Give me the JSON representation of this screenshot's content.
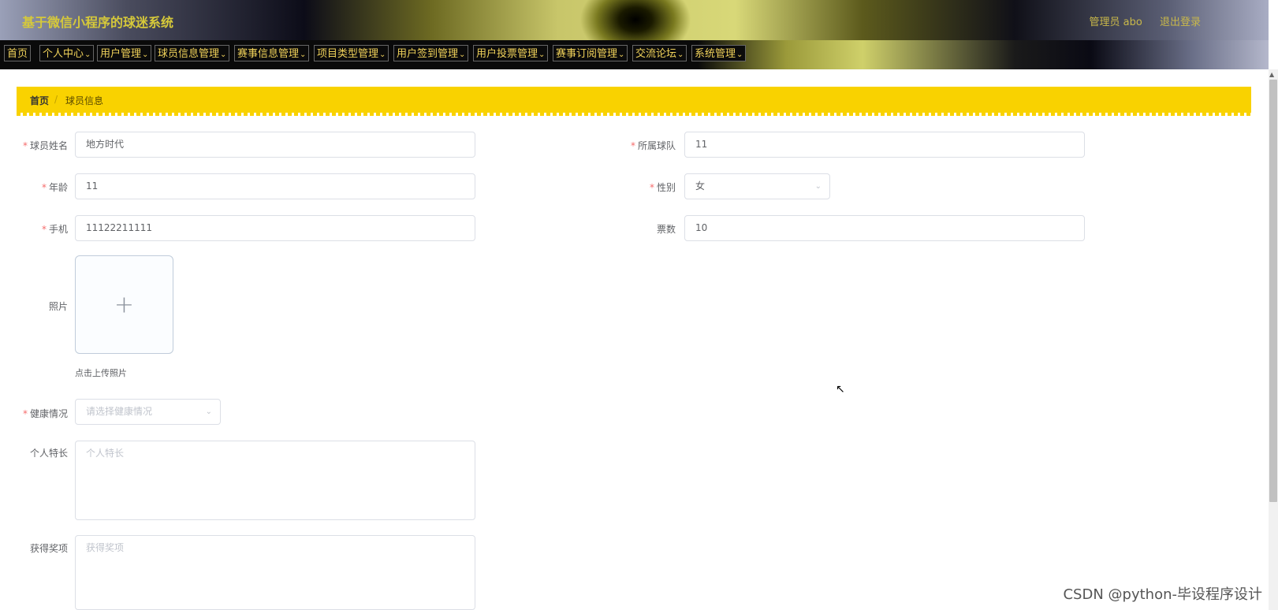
{
  "header": {
    "title": "基于微信小程序的球迷系统",
    "user_label": "管理员 abo",
    "logout_label": "退出登录"
  },
  "nav": {
    "items": [
      "首页",
      "个人中心",
      "用户管理",
      "球员信息管理",
      "赛事信息管理",
      "项目类型管理",
      "用户签到管理",
      "用户投票管理",
      "赛事订阅管理",
      "交流论坛",
      "系统管理"
    ]
  },
  "breadcrumb": {
    "home": "首页",
    "separator": "/",
    "current": "球员信息"
  },
  "form": {
    "player_name": {
      "label": "球员姓名",
      "value": "地方时代"
    },
    "team": {
      "label": "所属球队",
      "value": "11"
    },
    "age": {
      "label": "年龄",
      "value": "11"
    },
    "gender": {
      "label": "性别",
      "value": "女"
    },
    "phone": {
      "label": "手机",
      "value": "11122211111"
    },
    "votes": {
      "label": "票数",
      "value": "10"
    },
    "photo": {
      "label": "照片",
      "tip": "点击上传照片"
    },
    "health": {
      "label": "健康情况",
      "placeholder": "请选择健康情况"
    },
    "specialty": {
      "label": "个人特长",
      "placeholder": "个人特长"
    },
    "awards": {
      "label": "获得奖项",
      "placeholder": "获得奖项"
    }
  },
  "required_mark": "*",
  "watermark": "CSDN @python-毕设程序设计",
  "colors": {
    "accent": "#f9d200",
    "nav_text": "#f0d25a",
    "required": "#f56c6c"
  }
}
